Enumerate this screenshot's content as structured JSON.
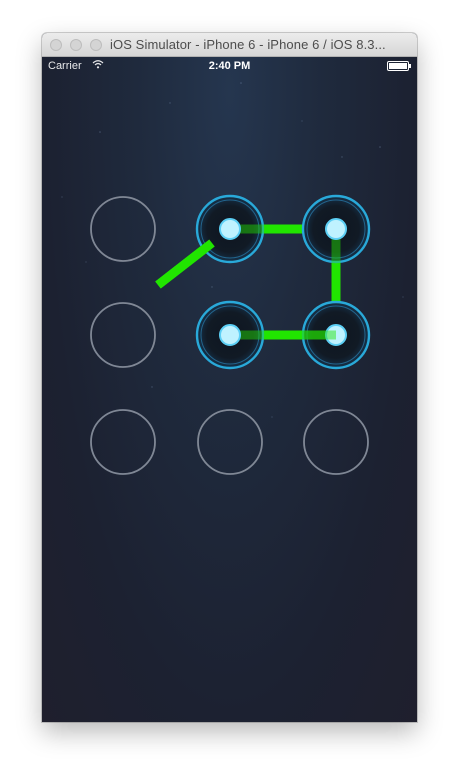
{
  "window": {
    "title": "iOS Simulator - iPhone 6 - iPhone 6 / iOS 8.3..."
  },
  "statusbar": {
    "carrier": "Carrier",
    "wifi_icon": "wifi-icon",
    "time": "2:40 PM",
    "battery_icon": "battery-full-icon"
  },
  "pattern_lock": {
    "grid": "3x3",
    "selected_nodes": [
      2,
      3,
      6,
      5
    ],
    "in_progress_stroke": true,
    "colors": {
      "ring": "#8b92a0",
      "active_ring": "#29a9d9",
      "node_dot": "#bff2ff",
      "line": "#21e500",
      "background": "#1c2233"
    }
  }
}
